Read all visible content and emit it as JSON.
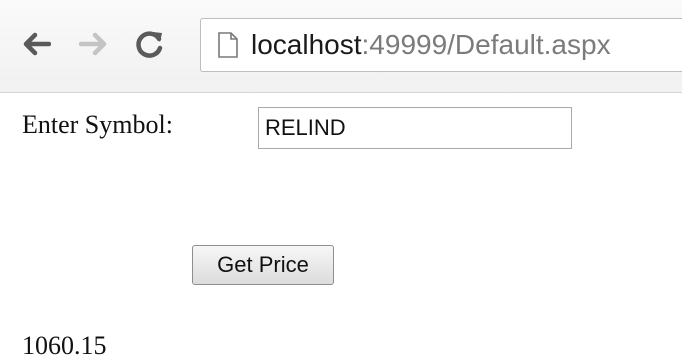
{
  "browser": {
    "url_host": "localhost",
    "url_rest": ":49999/Default.aspx",
    "icons": {
      "back": "back-arrow-icon",
      "forward": "forward-arrow-icon",
      "reload": "reload-icon",
      "page": "page-icon"
    }
  },
  "form": {
    "symbol_label": "Enter Symbol:",
    "symbol_value": "RELIND",
    "button_label": "Get Price",
    "result": "1060.15"
  }
}
